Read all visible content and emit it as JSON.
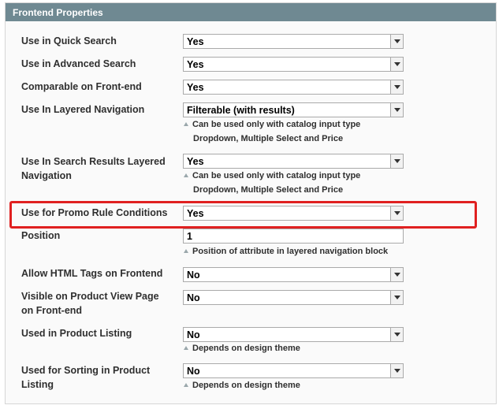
{
  "header": {
    "title": "Frontend Properties"
  },
  "fields": {
    "quick_search": {
      "label": "Use in Quick Search",
      "value": "Yes"
    },
    "advanced_search": {
      "label": "Use in Advanced Search",
      "value": "Yes"
    },
    "comparable": {
      "label": "Comparable on Front-end",
      "value": "Yes"
    },
    "layered_nav": {
      "label": "Use In Layered Navigation",
      "value": "Filterable (with results)",
      "note_line1": "Can be used only with catalog input type",
      "note_line2": "Dropdown, Multiple Select and Price"
    },
    "search_layered": {
      "label_line1": "Use In Search Results Layered",
      "label_line2": "Navigation",
      "value": "Yes",
      "note_line1": "Can be used only with catalog input type",
      "note_line2": "Dropdown, Multiple Select and Price"
    },
    "promo_rule": {
      "label": "Use for Promo Rule Conditions",
      "value": "Yes"
    },
    "position": {
      "label": "Position",
      "value": "1",
      "note": "Position of attribute in layered navigation block"
    },
    "html_tags": {
      "label": "Allow HTML Tags on Frontend",
      "value": "No"
    },
    "product_view": {
      "label_line1": "Visible on Product View Page",
      "label_line2": "on Front-end",
      "value": "No"
    },
    "product_listing": {
      "label": "Used in Product Listing",
      "value": "No",
      "note": "Depends on design theme"
    },
    "sorting": {
      "label_line1": "Used for Sorting in Product",
      "label_line2": "Listing",
      "value": "No",
      "note": "Depends on design theme"
    }
  },
  "colors": {
    "header_bg": "#6f8992",
    "highlight": "#e02020"
  },
  "icons": {
    "select_arrow": "chevron-down-icon",
    "note_marker": "triangle-up-icon"
  }
}
